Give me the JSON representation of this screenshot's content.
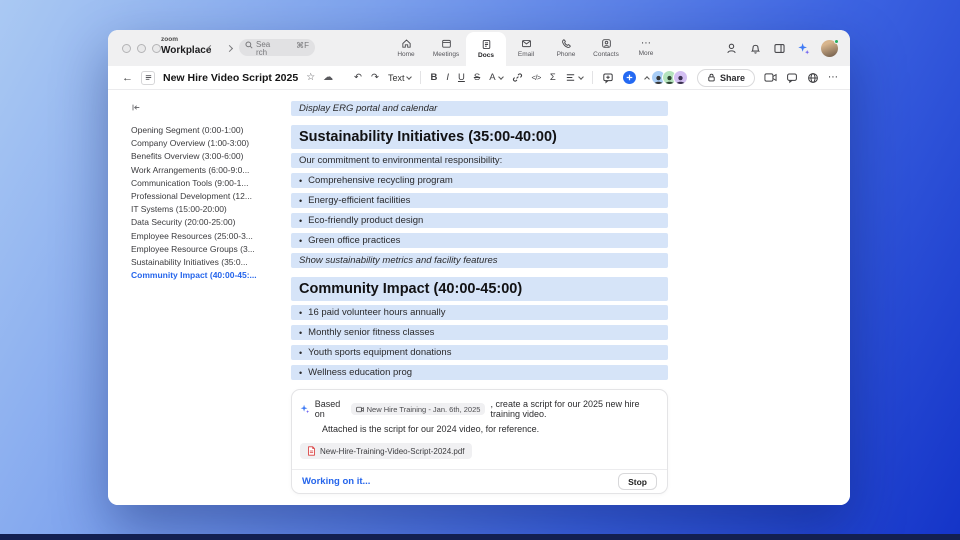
{
  "app": {
    "name_top": "zoom",
    "name_bottom": "Workplace"
  },
  "titlebar": {
    "search": {
      "line1": "Sea",
      "line2": "rch",
      "shortcut": "⌘F"
    },
    "nav": [
      {
        "label": "Home"
      },
      {
        "label": "Meetings"
      },
      {
        "label": "Docs"
      },
      {
        "label": "Email"
      },
      {
        "label": "Phone"
      },
      {
        "label": "Contacts"
      },
      {
        "label": "More"
      }
    ]
  },
  "toolbar": {
    "doc_title": "New Hire Video Script 2025",
    "text_style": "Text",
    "format": {
      "bold": "B",
      "italic": "I",
      "underline": "U",
      "strikethrough": "S",
      "color": "A"
    },
    "share_label": "Share"
  },
  "glyphs": {
    "back": "←",
    "undo": "↶",
    "redo": "↷",
    "star": "☆",
    "cloud": "☁",
    "sigma": "Σ",
    "code": "</>",
    "more": "⋯"
  },
  "sidebar": {
    "items": [
      {
        "label": "Opening Segment (0:00-1:00)"
      },
      {
        "label": "Company Overview (1:00-3:00)"
      },
      {
        "label": "Benefits Overview (3:00-6:00)"
      },
      {
        "label": "Work Arrangements (6:00-9:0..."
      },
      {
        "label": "Communication Tools (9:00-1..."
      },
      {
        "label": "Professional Development (12..."
      },
      {
        "label": "IT Systems (15:00-20:00)"
      },
      {
        "label": "Data Security (20:00-25:00)"
      },
      {
        "label": "Employee Resources (25:00-3..."
      },
      {
        "label": "Employee Resource Groups (3..."
      },
      {
        "label": "Sustainability Initiatives (35:0..."
      },
      {
        "label": "Community Impact (40:00-45:..."
      }
    ]
  },
  "document": {
    "rows": [
      {
        "text": "Display ERG portal and calendar"
      },
      {
        "text": "Sustainability Initiatives (35:00-40:00)"
      },
      {
        "text": "Our commitment to environmental responsibility:"
      },
      {
        "text": "Comprehensive recycling program"
      },
      {
        "text": "Energy-efficient facilities"
      },
      {
        "text": "Eco-friendly product design"
      },
      {
        "text": "Green office practices"
      },
      {
        "text": "Show sustainability metrics and facility features"
      },
      {
        "text": "Community Impact (40:00-45:00)"
      },
      {
        "text": "16 paid volunteer hours annually"
      },
      {
        "text": "Monthly senior fitness classes"
      },
      {
        "text": "Youth sports equipment donations"
      },
      {
        "text": "Wellness education prog"
      }
    ]
  },
  "ai_panel": {
    "prefix": "Based on",
    "source_chip": "New Hire Training - Jan. 6th, 2025",
    "prompt_rest": ", create a script for our 2025 new hire training video.",
    "prompt_line2": "Attached is the script for our 2024 video, for reference.",
    "attachment": "New-Hire-Training-Video-Script-2024.pdf",
    "status": "Working on it...",
    "stop_label": "Stop"
  },
  "colors": {
    "accent_blue": "#2469f2",
    "highlight": "#d6e4f8",
    "active_link": "#2565eb"
  }
}
